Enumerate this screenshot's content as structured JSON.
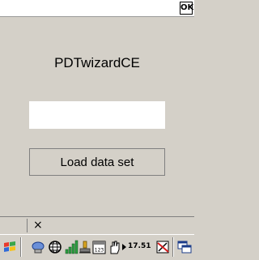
{
  "title_bar": {
    "ok_label": "OK"
  },
  "main": {
    "app_title": "PDTwizardCE",
    "input_value": "",
    "load_button_label": "Load data set"
  },
  "command_bar": {
    "close_label": "×"
  },
  "taskbar": {
    "clock": "17.51",
    "icons": [
      "windows-start-icon",
      "network-icon",
      "globe-icon",
      "signal-icon",
      "usb-icon",
      "keyboard-123-icon",
      "hand-icon",
      "arrow-right-icon",
      "sync-off-icon",
      "windows-switch-icon"
    ]
  },
  "colors": {
    "background": "#d4d0c8",
    "title_bar": "#ffffff",
    "input": "#ffffff"
  }
}
